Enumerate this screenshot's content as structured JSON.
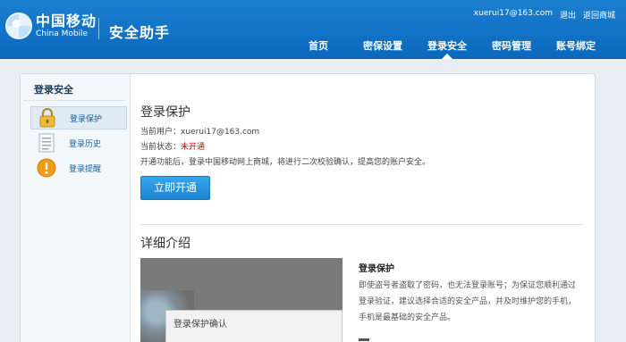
{
  "header": {
    "logo_cn": "中国移动",
    "logo_en": "China Mobile",
    "app_title": "安全助手",
    "user_email": "xuerui17@163.com",
    "logout": "退出",
    "back_to_mall": "返回商城"
  },
  "nav": {
    "items": [
      {
        "label": "首页"
      },
      {
        "label": "密保设置"
      },
      {
        "label": "登录安全"
      },
      {
        "label": "密码管理"
      },
      {
        "label": "账号绑定"
      }
    ],
    "active_index": 2
  },
  "sidebar": {
    "title": "登录安全",
    "items": [
      {
        "label": "登录保护",
        "icon": "lock-icon"
      },
      {
        "label": "登录历史",
        "icon": "document-icon"
      },
      {
        "label": "登录提醒",
        "icon": "alert-icon"
      }
    ],
    "active_index": 0
  },
  "content": {
    "title": "登录保护",
    "current_user_label": "当前用户：",
    "current_user": "xuerui17@163.com",
    "status_label": "当前状态：",
    "status_value": "未开通",
    "description": "开通功能后，登录中国移动网上商城，将进行二次校验确认，提高您的账户安全。",
    "enable_button": "立即开通",
    "detail_title": "详细介绍",
    "preview_dialog_title": "登录保护确认",
    "detail_heading": "登录保护",
    "detail_text": "即使盗号者盗取了密码，也无法登录账号；为保证您顺利通过登录验证，建议选择合适的安全产品，并及时维护您的手机，手机是最基础的安全产品。"
  },
  "colors": {
    "header_blue": "#0b68bd",
    "button_blue": "#1d86d2",
    "status_red": "#d60000"
  }
}
